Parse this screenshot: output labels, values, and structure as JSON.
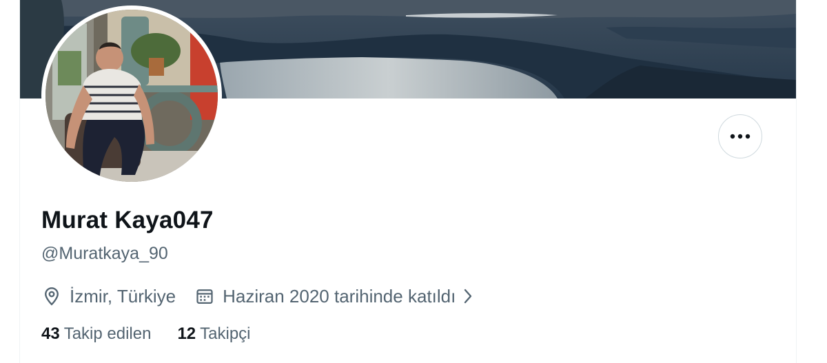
{
  "profile": {
    "display_name": "Murat Kaya047",
    "handle": "@Muratkaya_90",
    "location": "İzmir, Türkiye",
    "joined": "Haziran 2020 tarihinde katıldı",
    "following_count": "43",
    "following_label": "Takip edilen",
    "followers_count": "12",
    "followers_label": "Takipçi"
  },
  "icons": {
    "more": "more-horizontal-icon",
    "location": "location-pin-icon",
    "calendar": "calendar-icon",
    "chevron": "chevron-right-icon"
  },
  "colors": {
    "text_primary": "#0f1419",
    "text_secondary": "#536471",
    "border": "#cfd9de"
  }
}
